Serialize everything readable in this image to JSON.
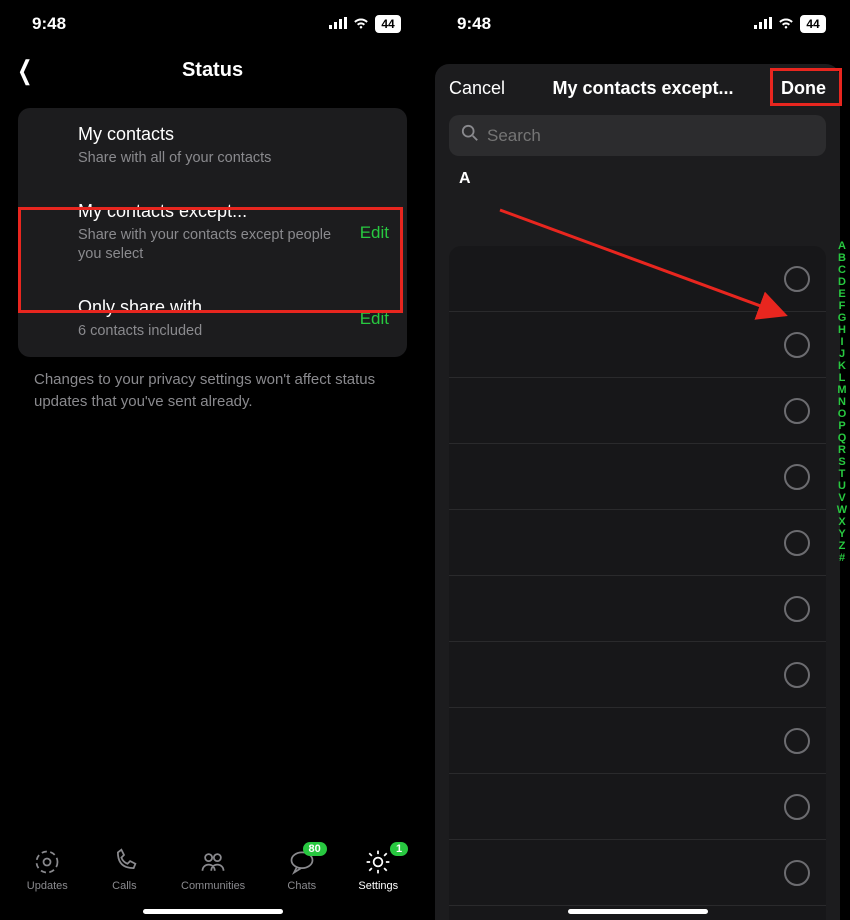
{
  "status": {
    "time": "9:48",
    "battery": "44"
  },
  "left": {
    "nav_title": "Status",
    "rows": [
      {
        "title": "My contacts",
        "sub": "Share with all of your contacts",
        "action": ""
      },
      {
        "title": "My contacts except...",
        "sub": "Share with your contacts except people you select",
        "action": "Edit"
      },
      {
        "title": "Only share with...",
        "sub": "6 contacts included",
        "action": "Edit"
      }
    ],
    "footer": "Changes to your privacy settings won't affect status updates that you've sent already.",
    "tabs": {
      "updates": "Updates",
      "calls": "Calls",
      "communities": "Communities",
      "chats": "Chats",
      "settings": "Settings",
      "chats_badge": "80",
      "settings_badge": "1"
    }
  },
  "right": {
    "cancel": "Cancel",
    "title": "My contacts except...",
    "done": "Done",
    "search_placeholder": "Search",
    "section": "A",
    "alphabet": [
      "A",
      "B",
      "C",
      "D",
      "E",
      "F",
      "G",
      "H",
      "I",
      "J",
      "K",
      "L",
      "M",
      "N",
      "O",
      "P",
      "Q",
      "R",
      "S",
      "T",
      "U",
      "V",
      "W",
      "X",
      "Y",
      "Z",
      "#"
    ],
    "contact_count": 10
  },
  "colors": {
    "accent": "#28c840",
    "highlight": "#e8261f"
  }
}
